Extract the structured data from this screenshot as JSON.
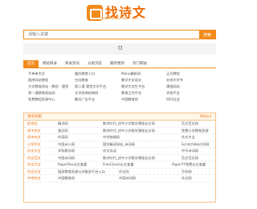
{
  "brand": {
    "name": "找诗文",
    "url": "www.zhaoshiwen.com",
    "color": "#f38b1c"
  },
  "search": {
    "placeholder": "请输入关键",
    "button": "搜索"
  },
  "banner": {
    "glyph": "℧"
  },
  "tabs": [
    "首页",
    "网站目录",
    "目录资讯",
    "分类浏览",
    "最新更新",
    "热门网站"
  ],
  "links": [
    [
      "手单单大学",
      "重庆教育人口",
      "Manu最新网",
      "正式教程"
    ],
    [
      "图库网站教程",
      "空间教育",
      "教学大学语文",
      "名师大学专"
    ],
    [
      "大学教育网站 - 教程 - 课堂",
      "第二课 课堂大学平台",
      "教学大学生平台",
      "课程网站"
    ],
    [
      "第一通教育网站网",
      "文学经典经典网",
      "教育工作平台",
      "学校平台"
    ],
    [
      "免费教程资源中心",
      "腾讯广告平台",
      "中国教育网",
      "SEO社会"
    ]
  ],
  "section": {
    "title": "诗文导航",
    "more": "More+",
    "rows": [
      [
        "综合站",
        "精灵网",
        "数学时代_初中小学数学课程论文网",
        "范文范文网"
      ],
      [
        "初中作文",
        "课文网",
        "数学时代_初中小学数学课程论文网",
        "免费小学教育资源"
      ],
      [
        "初中作文",
        "作家网",
        "中学物理网",
        "作文大全"
      ],
      [
        "小学作文",
        "中国诗人网",
        "国学精读网站_诗词网",
        "ScratchBash学网"
      ],
      [
        "作文大全",
        "学科教学网",
        "作文导读",
        "中华诗词网"
      ],
      [
        "作文范文",
        "中国诗词网",
        "数学时代_初中小学数学课程论文网",
        "范文范文网"
      ],
      [
        "作文大全",
        "PaperPen论文查重",
        "FreeCheck论文查重",
        "PaperYY免费论文查重"
      ],
      [
        "作文大全",
        "国家教育资源公共服务平台入口",
        "作文网",
        "写作网"
      ],
      [
        "中考作文",
        "中国教育网",
        "中国诗词网",
        "作文网"
      ]
    ]
  }
}
